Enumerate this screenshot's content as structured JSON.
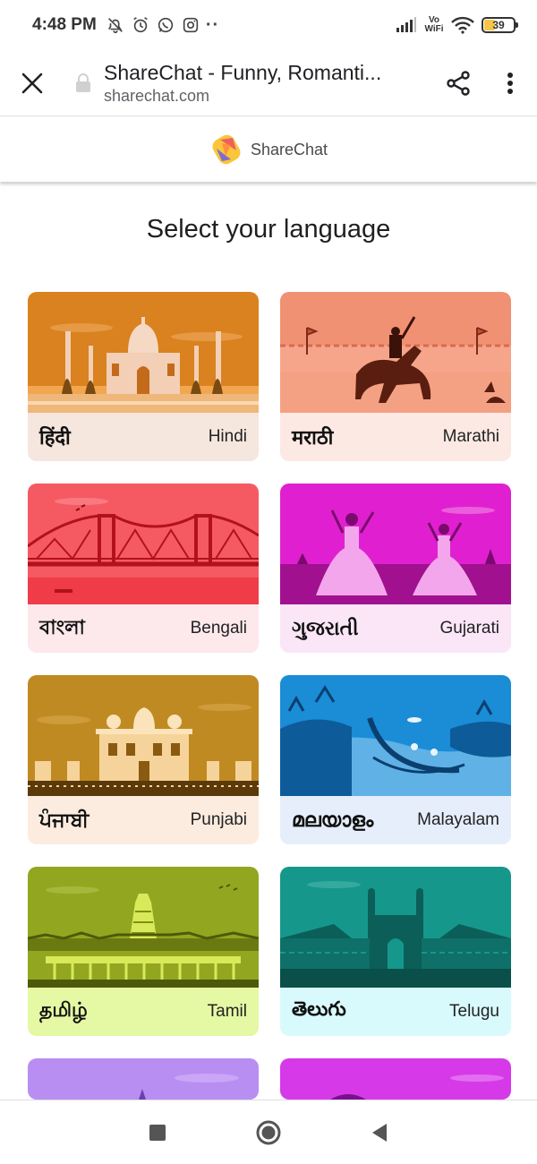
{
  "status": {
    "time": "4:48 PM",
    "vowifi": "Vo WiFi",
    "battery": "39"
  },
  "browser": {
    "title": "ShareChat - Funny, Romanti...",
    "url": "sharechat.com"
  },
  "brand": {
    "name": "ShareChat"
  },
  "page": {
    "heading": "Select your language"
  },
  "languages": [
    {
      "native": "हिंदी",
      "english": "Hindi",
      "art": "#d9821f",
      "label_bg": "#f5e6de"
    },
    {
      "native": "मराठी",
      "english": "Marathi",
      "art": "#f19173",
      "label_bg": "#fde9e4"
    },
    {
      "native": "বাংলা",
      "english": "Bengali",
      "art": "#f55a63",
      "label_bg": "#fde8ec"
    },
    {
      "native": "ગુજરાતી",
      "english": "Gujarati",
      "art": "#e020d0",
      "label_bg": "#fbe6f8"
    },
    {
      "native": "ਪੰਜਾਬੀ",
      "english": "Punjabi",
      "art": "#c08a22",
      "label_bg": "#fcece0"
    },
    {
      "native": "മലയാളം",
      "english": "Malayalam",
      "art": "#1b8cd6",
      "label_bg": "#e6eefb"
    },
    {
      "native": "தமிழ்",
      "english": "Tamil",
      "art": "#93a620",
      "label_bg": "#e5f8a4"
    },
    {
      "native": "తెలుగు",
      "english": "Telugu",
      "art": "#16978c",
      "label_bg": "#d9fafc"
    },
    {
      "native": "",
      "english": "",
      "art": "#b98ef2",
      "label_bg": "#f0e6fd"
    },
    {
      "native": "",
      "english": "",
      "art": "#d63ae8",
      "label_bg": "#fae6fc"
    }
  ]
}
